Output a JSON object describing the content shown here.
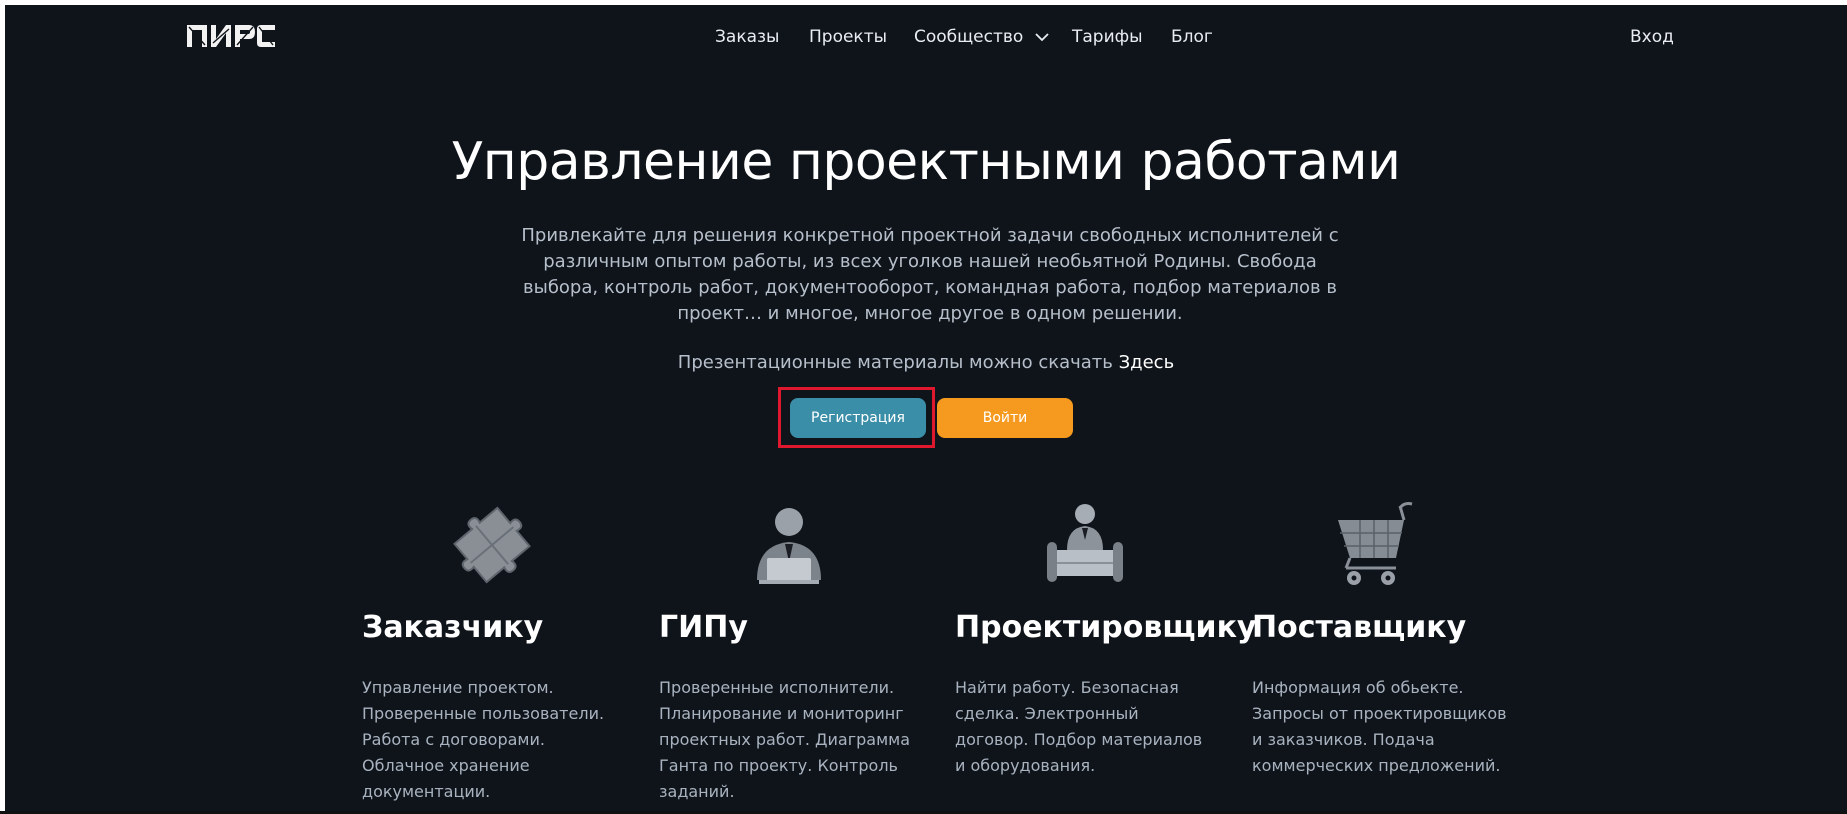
{
  "brand": {
    "logo_text": "ПИРС"
  },
  "nav": {
    "items": [
      {
        "label": "Заказы"
      },
      {
        "label": "Проекты"
      },
      {
        "label": "Сообщество",
        "has_dropdown": true
      },
      {
        "label": "Тарифы"
      },
      {
        "label": "Блог"
      }
    ],
    "login_label": "Вход"
  },
  "hero": {
    "title": "Управление проектными работами",
    "description": "Привлекайте для решения конкретной проектной задачи свободных исполнителей с различным опытом работы, из всех уголков нашей необьятной Родины. Свобода выбора, контроль работ, документооборот, командная работа, подбор материалов в проект… и многое, многое другое в одном решении.",
    "download_text": "Презентационные материалы можно скачать",
    "download_link": "Здесь",
    "register_button": "Регистрация",
    "login_button": "Войти"
  },
  "features": [
    {
      "icon": "puzzle-icon",
      "title": "Заказчику",
      "description": "Управление проектом. Проверенные пользователи. Работа с договорами. Облачное хранение документации."
    },
    {
      "icon": "manager-laptop-icon",
      "title": "ГИПу",
      "description": "Проверенные исполнители. Планирование и мониторинг проектных работ. Диаграмма Ганта по проекту. Контроль заданий."
    },
    {
      "icon": "designer-drafting-icon",
      "title": "Проектировщику",
      "description": "Найти работу. Безопасная сделка. Электронный договор. Подбор материалов и оборудования."
    },
    {
      "icon": "shopping-cart-icon",
      "title": "Поставщику",
      "description": "Информация об обьекте. Запросы от проектировщиков и заказчиков. Подача коммерческих предложений."
    }
  ],
  "colors": {
    "background": "#0f141b",
    "register_button": "#3b8ea8",
    "login_button": "#f59a1e",
    "highlight_border": "#e0182d"
  }
}
